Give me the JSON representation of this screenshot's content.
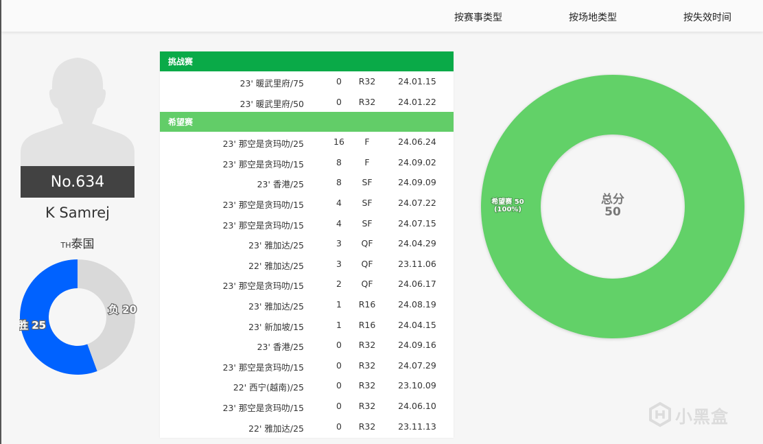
{
  "nav": [
    {
      "label": "按赛事类型"
    },
    {
      "label": "按场地类型"
    },
    {
      "label": "按失效时间"
    }
  ],
  "player": {
    "number": "No.634",
    "name": "K Samrej",
    "country_code": "TH",
    "country": "泰国"
  },
  "wl": {
    "win_label": "胜 25",
    "loss_label": "负 20",
    "wins": 25,
    "losses": 20,
    "colors": {
      "win": "#0062ff",
      "loss": "#d9d9d9"
    }
  },
  "groups": [
    {
      "name": "挑战赛",
      "rows": [
        {
          "event": "23' 暖武里府/75",
          "points": "0",
          "round": "R32",
          "date": "24.01.15"
        },
        {
          "event": "23' 暖武里府/50",
          "points": "0",
          "round": "R32",
          "date": "24.01.22"
        }
      ]
    },
    {
      "name": "希望赛",
      "rows": [
        {
          "event": "23' 那空是贪玛叻/25",
          "points": "16",
          "round": "F",
          "date": "24.06.24"
        },
        {
          "event": "23' 那空是贪玛叻/15",
          "points": "8",
          "round": "F",
          "date": "24.09.02"
        },
        {
          "event": "23' 香港/25",
          "points": "8",
          "round": "SF",
          "date": "24.09.09"
        },
        {
          "event": "23' 那空是贪玛叻/15",
          "points": "4",
          "round": "SF",
          "date": "24.07.22"
        },
        {
          "event": "23' 那空是贪玛叻/15",
          "points": "4",
          "round": "SF",
          "date": "24.07.15"
        },
        {
          "event": "23' 雅加达/25",
          "points": "3",
          "round": "QF",
          "date": "24.04.29"
        },
        {
          "event": "22' 雅加达/25",
          "points": "3",
          "round": "QF",
          "date": "23.11.06"
        },
        {
          "event": "23' 那空是贪玛叻/15",
          "points": "2",
          "round": "QF",
          "date": "24.06.17"
        },
        {
          "event": "23' 雅加达/25",
          "points": "1",
          "round": "R16",
          "date": "24.08.19"
        },
        {
          "event": "23' 新加坡/15",
          "points": "1",
          "round": "R16",
          "date": "24.04.15"
        },
        {
          "event": "23' 香港/25",
          "points": "0",
          "round": "R32",
          "date": "24.09.16"
        },
        {
          "event": "23' 那空是贪玛叻/15",
          "points": "0",
          "round": "R32",
          "date": "24.07.29"
        },
        {
          "event": "22' 西宁(越南)/25",
          "points": "0",
          "round": "R32",
          "date": "23.10.09"
        },
        {
          "event": "23' 那空是贪玛叻/15",
          "points": "0",
          "round": "R32",
          "date": "24.06.10"
        },
        {
          "event": "22' 雅加达/25",
          "points": "0",
          "round": "R32",
          "date": "23.11.13"
        }
      ]
    }
  ],
  "chart_data": {
    "type": "pie",
    "center_title": "总分",
    "center_value": "50",
    "slices": [
      {
        "name": "希望赛",
        "value": 50,
        "percent_label": "(100%)",
        "label": "希望赛 50",
        "color": "#62d168"
      }
    ]
  },
  "watermark": "小黑盒"
}
